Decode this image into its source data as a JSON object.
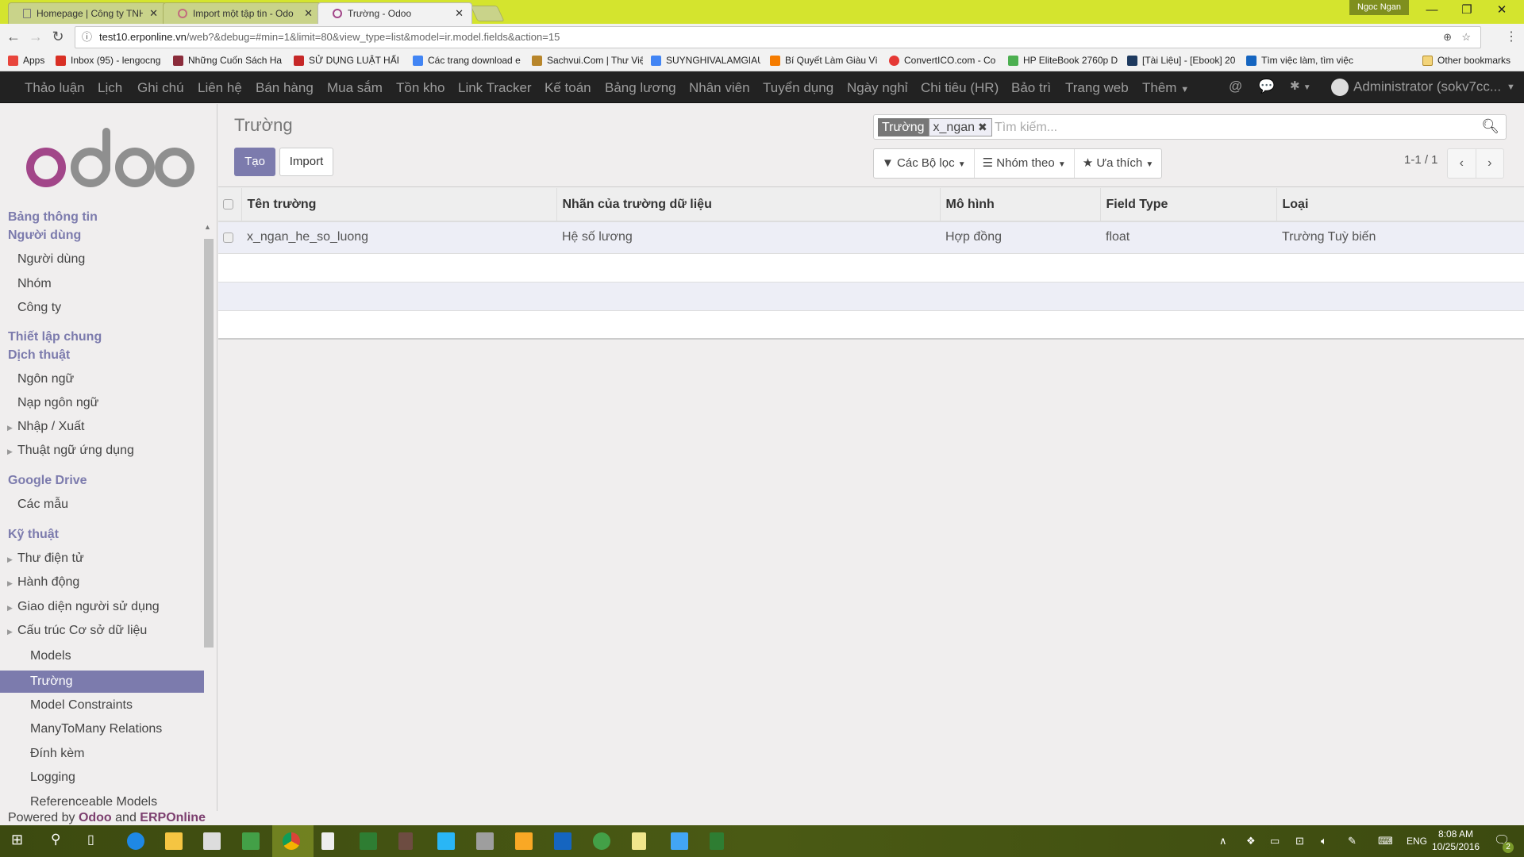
{
  "browser": {
    "tabs": [
      {
        "label": "Homepage | Công ty TNH",
        "icon": "document-icon",
        "active": false
      },
      {
        "label": "Import một tập tin - Odo",
        "icon": "odoo-icon",
        "active": false
      },
      {
        "label": "Trường - Odoo",
        "icon": "odoo-icon",
        "active": true
      }
    ],
    "profile_name": "Ngoc Ngan",
    "url_host": "test10.erponline.vn",
    "url_rest": "/web?&debug=#min=1&limit=80&view_type=list&model=ir.model.fields&action=15",
    "bookmarks": [
      {
        "label": "Apps",
        "color": "#e8453c"
      },
      {
        "label": "Inbox (95) - lengocng",
        "color": "#d93025"
      },
      {
        "label": "Những Cuốn Sách Ha",
        "color": "#8b2c3b"
      },
      {
        "label": "SỬ DỤNG LUẬT HẤP",
        "color": "#c62828"
      },
      {
        "label": "Các trang download e",
        "color": "#4285f4"
      },
      {
        "label": "Sachvui.Com | Thư Việ",
        "color": "#b8862b"
      },
      {
        "label": "SUYNGHIVALAMGIAU",
        "color": "#4285f4"
      },
      {
        "label": "Bí Quyết Làm Giàu Vì",
        "color": "#f57c00"
      },
      {
        "label": "ConvertICO.com - Co",
        "color": "#e53935"
      },
      {
        "label": "HP EliteBook 2760p D",
        "color": "#4caf50"
      },
      {
        "label": "[Tài Liệu] - [Ebook] 20",
        "color": "#1e3a5f"
      },
      {
        "label": "Tìm việc làm, tìm việc",
        "color": "#1565c0"
      }
    ],
    "other_bookmarks": "Other bookmarks"
  },
  "topnav": {
    "items": [
      "Thảo luận",
      "Lịch",
      "Ghi chú",
      "Liên hệ",
      "Bán hàng",
      "Mua sắm",
      "Tồn kho",
      "Link Tracker",
      "Kế toán",
      "Bảng lương",
      "Nhân viên",
      "Tuyển dụng",
      "Ngày nghỉ",
      "Chi tiêu (HR)",
      "Bảo trì",
      "Trang web",
      "Thêm"
    ],
    "user": "Administrator (sokv7cc..."
  },
  "sidebar": {
    "sections": [
      {
        "title": "Bảng thông tin"
      },
      {
        "title": "Người dùng",
        "items": [
          "Người dùng",
          "Nhóm",
          "Công ty"
        ]
      },
      {
        "title": "Thiết lập chung"
      },
      {
        "title": "Dịch thuật",
        "items": [
          "Ngôn ngữ",
          "Nạp ngôn ngữ",
          "Nhập / Xuất",
          "Thuật ngữ ứng dụng"
        ]
      },
      {
        "title": "Google Drive",
        "items": [
          "Các mẫu"
        ]
      },
      {
        "title": "Kỹ thuật",
        "items": [
          "Thư điện tử",
          "Hành động",
          "Giao diện người sử dụng",
          "Cấu trúc Cơ sở dữ liệu"
        ]
      }
    ],
    "db_subitems": [
      "Models",
      "Trường",
      "Model Constraints",
      "ManyToMany Relations",
      "Đính kèm",
      "Logging",
      "Referenceable Models"
    ],
    "active_item": "Trường",
    "powered_prefix": "Powered by ",
    "powered_odoo": "Odoo",
    "powered_and": " and ",
    "powered_erp": "ERPOnline"
  },
  "controlpanel": {
    "breadcrumb": "Trường",
    "create_label": "Tạo",
    "import_label": "Import",
    "facet_label": "Trường",
    "facet_value": "x_ngan",
    "search_placeholder": "Tìm kiếm...",
    "filters_label": "Các Bộ lọc",
    "groupby_label": "Nhóm theo",
    "favorites_label": "Ưa thích",
    "pager": "1-1 / 1"
  },
  "table": {
    "columns": [
      "Tên trường",
      "Nhãn của trường dữ liệu",
      "Mô hình",
      "Field Type",
      "Loại"
    ],
    "rows": [
      [
        "x_ngan_he_so_luong",
        "Hệ số lương",
        "Hợp đồng",
        "float",
        "Trường Tuỳ biến"
      ]
    ]
  },
  "taskbar": {
    "time": "8:08 AM",
    "date": "10/25/2016",
    "language": "ENG",
    "notifications": "2"
  },
  "colors": {
    "brand": "#7c7bad",
    "odoo_purple": "#a24689",
    "nav_bg": "#222222"
  }
}
